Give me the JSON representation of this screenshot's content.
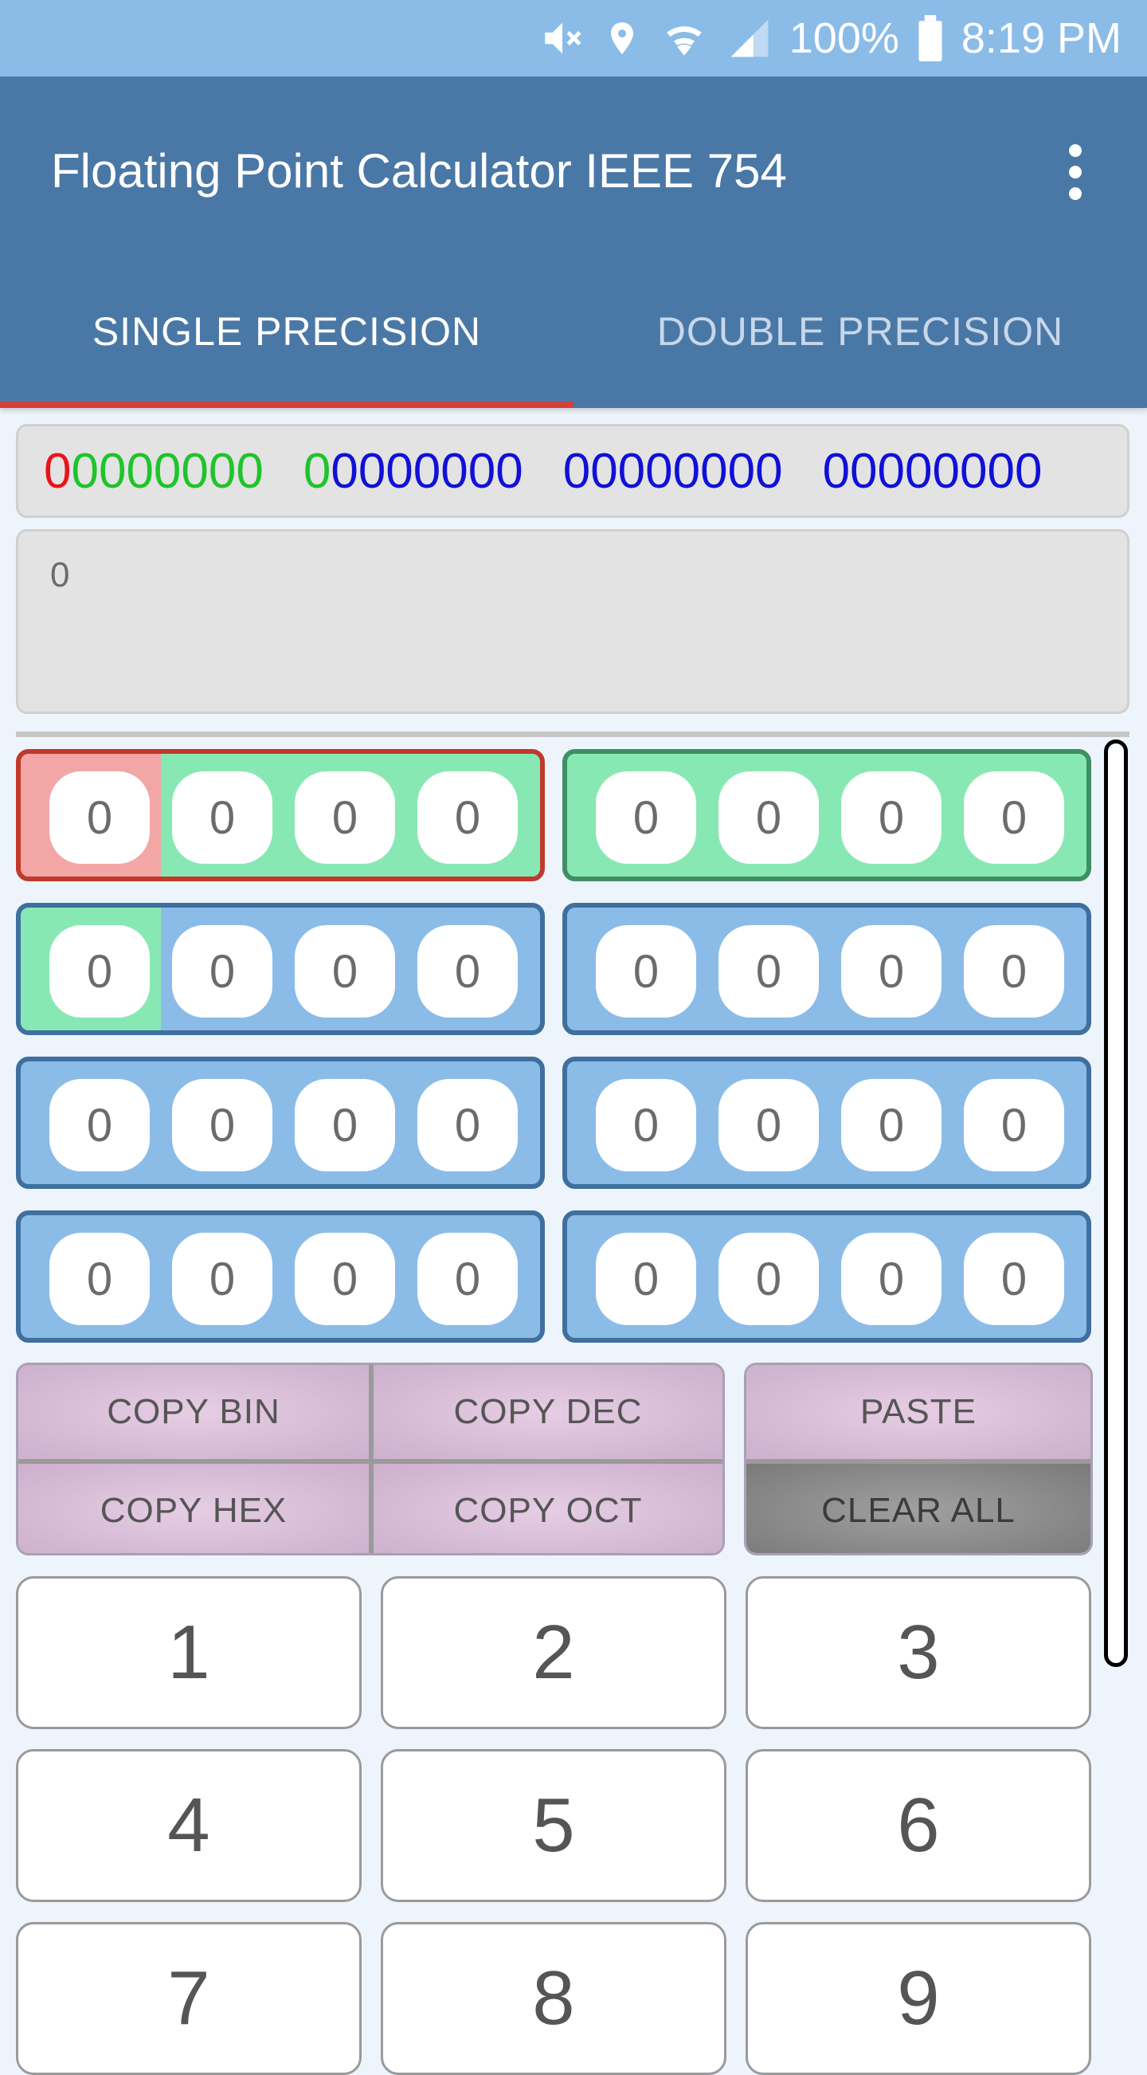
{
  "status_bar": {
    "battery": "100%",
    "time": "8:19 PM",
    "icons": [
      "mute-icon",
      "location-icon",
      "wifi-icon",
      "signal-icon",
      "battery-icon"
    ]
  },
  "app_bar": {
    "title": "Floating Point Calculator IEEE 754",
    "menu_icon": "overflow-menu-icon"
  },
  "tabs": [
    {
      "label": "SINGLE PRECISION",
      "active": true
    },
    {
      "label": "DOUBLE PRECISION",
      "active": false
    }
  ],
  "binary_display": {
    "groups": [
      {
        "sign": "0",
        "rest": "0000000"
      },
      {
        "exp": "0",
        "rest": "0000000"
      },
      {
        "mantissa": "00000000"
      },
      {
        "mantissa": "00000000"
      }
    ]
  },
  "decimal_display": {
    "value": "0"
  },
  "bits": [
    "0",
    "0",
    "0",
    "0",
    "0",
    "0",
    "0",
    "0",
    "0",
    "0",
    "0",
    "0",
    "0",
    "0",
    "0",
    "0",
    "0",
    "0",
    "0",
    "0",
    "0",
    "0",
    "0",
    "0",
    "0",
    "0",
    "0",
    "0",
    "0",
    "0",
    "0",
    "0"
  ],
  "copy_buttons": {
    "copy_bin": "COPY BIN",
    "copy_dec": "COPY DEC",
    "copy_hex": "COPY HEX",
    "copy_oct": "COPY OCT",
    "paste": "PASTE",
    "clear_all": "CLEAR ALL"
  },
  "keypad": [
    "1",
    "2",
    "3",
    "4",
    "5",
    "6",
    "7",
    "8",
    "9"
  ],
  "colors": {
    "sign": "#e8141b",
    "exponent": "#1ec42a",
    "mantissa": "#1010d8",
    "app_bar": "#4a78a6",
    "status_bar": "#8bbce8",
    "tab_indicator": "#d0413c"
  }
}
